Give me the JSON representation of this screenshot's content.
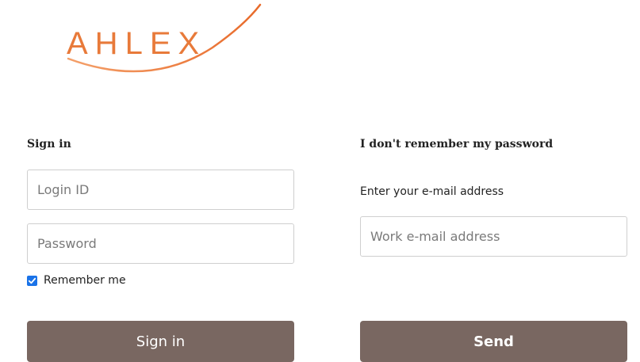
{
  "logo": {
    "text": "AHLEX",
    "colors": {
      "brand": "#e87a3a"
    }
  },
  "sign_in": {
    "title": "Sign in",
    "login_placeholder": "Login ID",
    "password_placeholder": "Password",
    "remember_label": "Remember me",
    "remember_checked": true,
    "button_label": "Sign in"
  },
  "forgot": {
    "title": "I don't remember my password",
    "hint": "Enter your e-mail address",
    "email_placeholder": "Work e-mail address",
    "button_label": "Send"
  },
  "colors": {
    "button_bg": "#796761",
    "button_text": "#ffffff",
    "checkbox": "#1a73e8"
  }
}
